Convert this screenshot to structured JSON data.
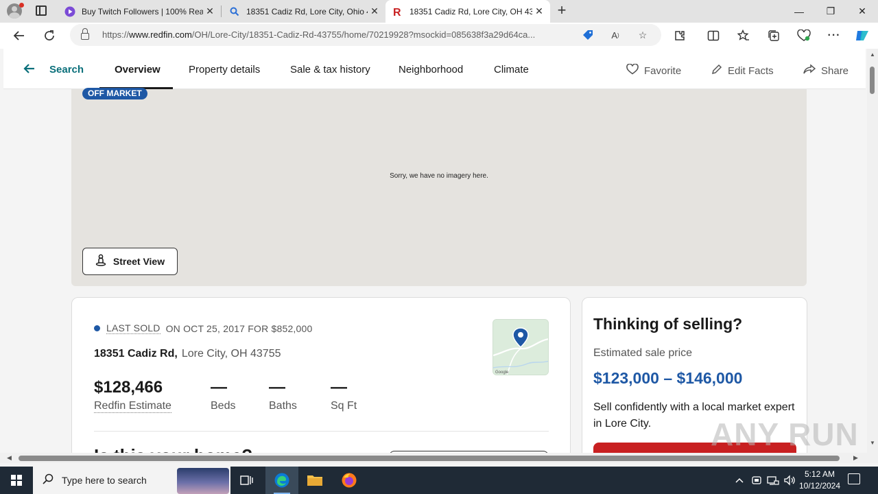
{
  "browser": {
    "tabs": [
      {
        "title": "Buy Twitch Followers | 100% Real",
        "icon": "twitch-style-icon",
        "active": false
      },
      {
        "title": "18351 Cadiz Rd, Lore City, Ohio 4",
        "icon": "search-icon",
        "active": false
      },
      {
        "title": "18351 Cadiz Rd, Lore City, OH 43",
        "icon": "redfin-icon",
        "active": true
      }
    ],
    "close_glyph": "✕",
    "new_tab_glyph": "+",
    "url_prefix": "https://",
    "url_host": "www.redfin.com",
    "url_path": "/OH/Lore-City/18351-Cadiz-Rd-43755/home/70219928?msockid=085638f3a29d64ca...",
    "window_controls": {
      "minimize": "—",
      "maximize": "❐",
      "close": "✕"
    }
  },
  "subnav": {
    "search": "Search",
    "tabs": [
      "Overview",
      "Property details",
      "Sale & tax history",
      "Neighborhood",
      "Climate"
    ],
    "favorite": "Favorite",
    "edit_facts": "Edit Facts",
    "share": "Share"
  },
  "map_panel": {
    "badge": "OFF MARKET",
    "no_imagery": "Sorry, we have no imagery here.",
    "street_view": "Street View"
  },
  "listing": {
    "last_sold_label": "LAST SOLD",
    "last_sold_detail": "ON OCT 25, 2017 FOR $852,000",
    "street": "18351 Cadiz Rd,",
    "city": "Lore City, OH 43755",
    "estimate_value": "$128,466",
    "estimate_label": "Redfin Estimate",
    "beds_value": "—",
    "beds_label": "Beds",
    "baths_value": "—",
    "baths_label": "Baths",
    "sqft_value": "—",
    "sqft_label": "Sq Ft"
  },
  "selling": {
    "title": "Thinking of selling?",
    "subtitle": "Estimated sale price",
    "range": "$123,000 – $146,000",
    "text": "Sell confidently with a local market expert in Lore City."
  },
  "watermark": "ANY RUN",
  "taskbar": {
    "search_placeholder": "Type here to search",
    "time": "5:12 AM",
    "date": "10/12/2024"
  },
  "colors": {
    "redfin_teal": "#0a6f7a",
    "redfin_blue": "#1e58a5",
    "redfin_red": "#c82021"
  }
}
